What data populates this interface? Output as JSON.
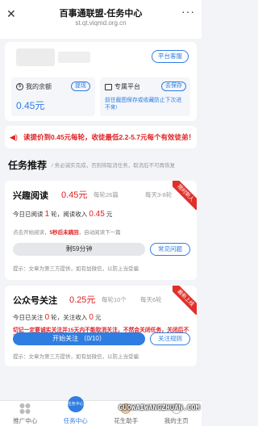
{
  "header": {
    "title": "百事通联盟-任务中心",
    "url": "st.qt.viqmd.org.cn"
  },
  "account": {
    "service_button": "平台客服",
    "balance": {
      "label": "我的余额",
      "value": "0.45元",
      "withdraw_button": "提现"
    },
    "platform": {
      "label": "专属平台",
      "save_button": "去保存",
      "desc": "前往截图保存或收藏防止下次进不来!"
    }
  },
  "notice": {
    "text": "读提价到0.45元每轮，收徒最低2.2-5.7元每个有效徒弟！"
  },
  "section": {
    "title": "任务推荐",
    "subtitle": "/ 务必诚实完成，否则将取消任务，取消后不可再恢复"
  },
  "tasks": [
    {
      "title": "兴趣阅读",
      "price": "0.45元",
      "meta1": "每轮26篇",
      "meta2": "每天3-8轮",
      "ribbon": "限时新人",
      "today_prefix": "今日已阅读",
      "today_count": "1",
      "today_unit": "轮，阅读收入",
      "today_income": "0.45",
      "income_unit": "元",
      "hint_pre": "点击开始阅读，",
      "hint_warn": "5秒后未跳回",
      "hint_post": "，自动阅读下一篇",
      "action_button": "剩59分钟",
      "faq_button": "常见问题",
      "footnote": "提示：文章为第三方提供，如有加微信，以防上当受骗"
    },
    {
      "title": "公众号关注",
      "price": "0.25元",
      "meta1": "每轮10个",
      "meta2": "每天6轮",
      "ribbon": "最新上线",
      "today_prefix": "今日已关注",
      "today_count": "0",
      "today_unit": "轮，关注收入",
      "today_income": "0",
      "income_unit": "元",
      "warn": "切记一定要诚实关注并15天内不能取消关注，不然会关闭任务，关闭后不可恢复!",
      "action_button": "开始关注 （0/10）",
      "faq_button": "关注规则",
      "footnote": "提示：文章为第三方提供，如有加微信，以防上当受骗"
    }
  ],
  "tabbar": [
    {
      "label": "推广中心",
      "icon": "grid-icon"
    },
    {
      "label": "任务中心",
      "icon": "task-center-icon",
      "active": true,
      "badge": "任务中心"
    },
    {
      "label": "花生助手",
      "icon": "assistant-avatar-icon"
    },
    {
      "label": "我的主页",
      "icon": "user-icon"
    }
  ],
  "watermark": "GUOWAIWANGZHUAN.COM",
  "colors": {
    "accent": "#2f7de1",
    "alert": "#e02020"
  }
}
